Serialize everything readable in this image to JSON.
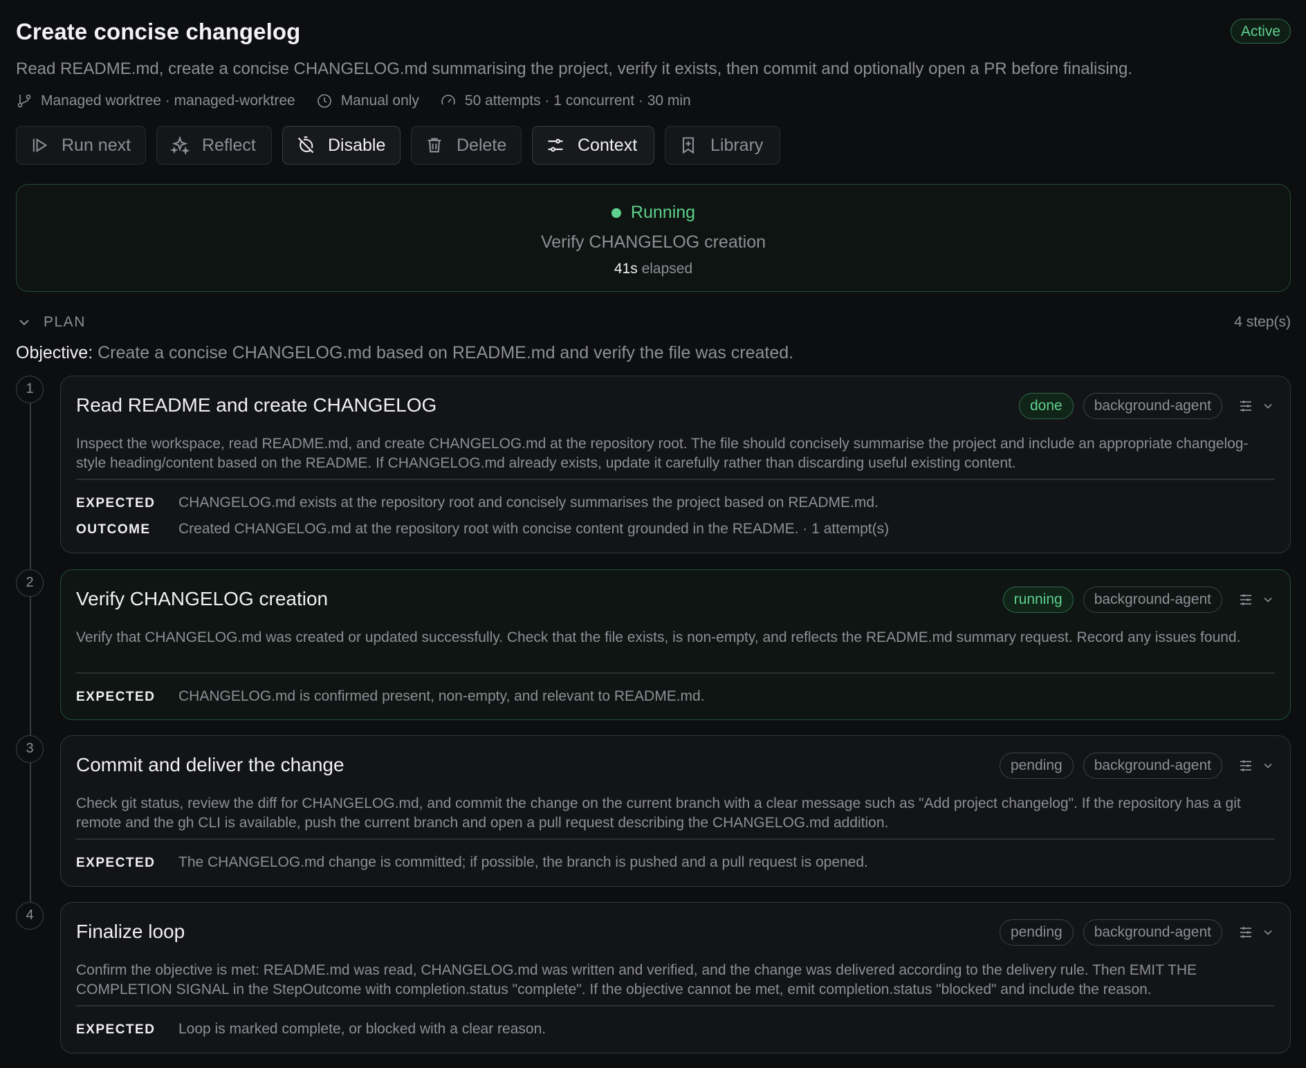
{
  "header": {
    "title": "Create concise changelog",
    "status_badge": "Active",
    "description": "Read README.md, create a concise CHANGELOG.md summarising the project, verify it exists, then commit and optionally open a PR before finalising.",
    "meta": {
      "worktree": "Managed worktree · managed-worktree",
      "trigger": "Manual only",
      "limits": "50 attempts · 1 concurrent · 30 min"
    }
  },
  "toolbar": {
    "run_next": "Run next",
    "reflect": "Reflect",
    "disable": "Disable",
    "delete": "Delete",
    "context": "Context",
    "library": "Library"
  },
  "running": {
    "status": "Running",
    "step": "Verify CHANGELOG creation",
    "elapsed_value": "41s",
    "elapsed_label": "elapsed"
  },
  "plan": {
    "label": "PLAN",
    "count": "4 step(s)",
    "objective_label": "Objective:",
    "objective": "Create a concise CHANGELOG.md based on README.md and verify the file was created.",
    "steps": [
      {
        "num": "1",
        "title": "Read README and create CHANGELOG",
        "status": "done",
        "agent": "background-agent",
        "description": "Inspect the workspace, read README.md, and create CHANGELOG.md at the repository root. The file should concisely summarise the project and include an appropriate changelog-style heading/content based on the README. If CHANGELOG.md already exists, update it carefully rather than discarding useful existing content.",
        "expected_label": "EXPECTED",
        "expected": "CHANGELOG.md exists at the repository root and concisely summarises the project based on README.md.",
        "outcome_label": "OUTCOME",
        "outcome": "Created CHANGELOG.md at the repository root with concise content grounded in the README. · 1 attempt(s)"
      },
      {
        "num": "2",
        "title": "Verify CHANGELOG creation",
        "status": "running",
        "agent": "background-agent",
        "description": "Verify that CHANGELOG.md was created or updated successfully. Check that the file exists, is non-empty, and reflects the README.md summary request. Record any issues found.",
        "expected_label": "EXPECTED",
        "expected": "CHANGELOG.md is confirmed present, non-empty, and relevant to README.md."
      },
      {
        "num": "3",
        "title": "Commit and deliver the change",
        "status": "pending",
        "agent": "background-agent",
        "description": "Check git status, review the diff for CHANGELOG.md, and commit the change on the current branch with a clear message such as \"Add project changelog\". If the repository has a git remote and the gh CLI is available, push the current branch and open a pull request describing the CHANGELOG.md addition.",
        "expected_label": "EXPECTED",
        "expected": "The CHANGELOG.md change is committed; if possible, the branch is pushed and a pull request is opened."
      },
      {
        "num": "4",
        "title": "Finalize loop",
        "status": "pending",
        "agent": "background-agent",
        "description": "Confirm the objective is met: README.md was read, CHANGELOG.md was written and verified, and the change was delivered according to the delivery rule. Then EMIT THE COMPLETION SIGNAL in the StepOutcome with completion.status \"complete\". If the objective cannot be met, emit completion.status \"blocked\" and include the reason.",
        "expected_label": "EXPECTED",
        "expected": "Loop is marked complete, or blocked with a clear reason."
      }
    ]
  },
  "colors": {
    "background": "#0d0e10",
    "accent_green": "#5fd08d",
    "muted_text": "#8e8f96",
    "card_border": "#34353b"
  }
}
